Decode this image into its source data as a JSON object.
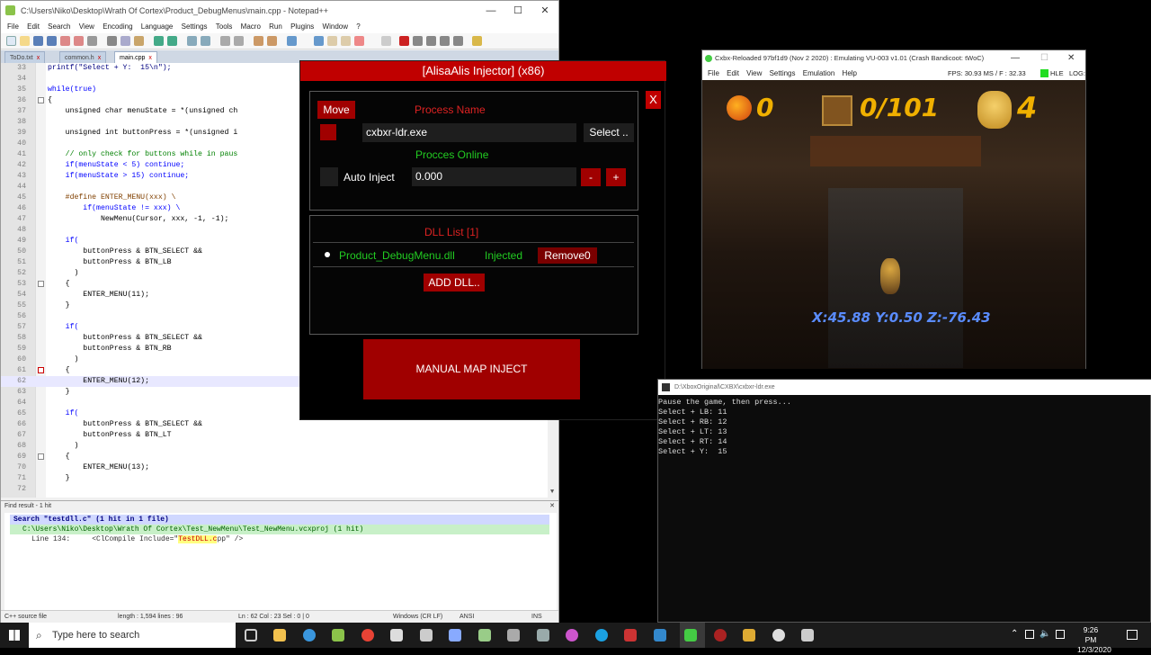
{
  "notepad": {
    "title": "C:\\Users\\Niko\\Desktop\\Wrath Of Cortex\\Product_DebugMenus\\main.cpp - Notepad++",
    "menu": [
      "File",
      "Edit",
      "Search",
      "View",
      "Encoding",
      "Language",
      "Settings",
      "Tools",
      "Macro",
      "Run",
      "Plugins",
      "Window",
      "?"
    ],
    "tabs": [
      "ToDo.txt",
      "common.h",
      "main.cpp"
    ],
    "lines": [
      {
        "n": "33",
        "t": "printf(\"Select + Y:  15\\n\");"
      },
      {
        "n": "34",
        "t": ""
      },
      {
        "n": "35",
        "t": "while(true)"
      },
      {
        "n": "36",
        "t": "{"
      },
      {
        "n": "37",
        "t": "    unsigned char menuState = *(unsigned ch"
      },
      {
        "n": "38",
        "t": ""
      },
      {
        "n": "39",
        "t": "    unsigned int buttonPress = *(unsigned i"
      },
      {
        "n": "40",
        "t": ""
      },
      {
        "n": "41",
        "t": "    // only check for buttons while in paus"
      },
      {
        "n": "42",
        "t": "    if(menuState < 5) continue;"
      },
      {
        "n": "43",
        "t": "    if(menuState > 15) continue;"
      },
      {
        "n": "44",
        "t": ""
      },
      {
        "n": "45",
        "t": "    #define ENTER_MENU(xxx) \\"
      },
      {
        "n": "46",
        "t": "        if(menuState != xxx) \\"
      },
      {
        "n": "47",
        "t": "            NewMenu(Cursor, xxx, -1, -1);"
      },
      {
        "n": "48",
        "t": ""
      },
      {
        "n": "49",
        "t": "    if("
      },
      {
        "n": "50",
        "t": "        buttonPress & BTN_SELECT &&"
      },
      {
        "n": "51",
        "t": "        buttonPress & BTN_LB"
      },
      {
        "n": "52",
        "t": "      )"
      },
      {
        "n": "53",
        "t": "    {"
      },
      {
        "n": "54",
        "t": "        ENTER_MENU(11);"
      },
      {
        "n": "55",
        "t": "    }"
      },
      {
        "n": "56",
        "t": ""
      },
      {
        "n": "57",
        "t": "    if("
      },
      {
        "n": "58",
        "t": "        buttonPress & BTN_SELECT &&"
      },
      {
        "n": "59",
        "t": "        buttonPress & BTN_RB"
      },
      {
        "n": "60",
        "t": "      )"
      },
      {
        "n": "61",
        "t": "    {"
      },
      {
        "n": "62",
        "t": "        ENTER_MENU(12);"
      },
      {
        "n": "63",
        "t": "    }"
      },
      {
        "n": "64",
        "t": ""
      },
      {
        "n": "65",
        "t": "    if("
      },
      {
        "n": "66",
        "t": "        buttonPress & BTN_SELECT &&"
      },
      {
        "n": "67",
        "t": "        buttonPress & BTN_LT"
      },
      {
        "n": "68",
        "t": "      )"
      },
      {
        "n": "69",
        "t": "    {"
      },
      {
        "n": "70",
        "t": "        ENTER_MENU(13);"
      },
      {
        "n": "71",
        "t": "    }"
      },
      {
        "n": "72",
        "t": ""
      }
    ],
    "find_bar": "Find result - 1 hit",
    "find": {
      "search": "Search \"testdll.c\" (1 hit in 1 file)",
      "file": "C:\\Users\\Niko\\Desktop\\Wrath Of Cortex\\Test_NewMenu\\Test_NewMenu.vcxproj (1 hit)",
      "line_prefix": "Line 134:     <ClCompile Include=\"",
      "line_hit": "TestDLL.c",
      "line_suffix": "pp\" />"
    },
    "status": {
      "type": "C++ source file",
      "length": "length : 1,594   lines : 96",
      "pos": "Ln : 62    Col : 23    Sel : 0 | 0",
      "eol": "Windows (CR LF)",
      "enc": "ANSI",
      "mode": "INS"
    }
  },
  "injector": {
    "title": "[AlisaAlis Injector] (x86)",
    "close": "X",
    "move": "Move",
    "process_name_label": "Process Name",
    "process_value": "cxbxr-ldr.exe",
    "select": "Select ..",
    "online": "Procces Online",
    "auto_inject": "Auto Inject",
    "delay": "0.000",
    "minus": "-",
    "plus": "+",
    "dll_list_title": "DLL List [1]",
    "dll_name": "Product_DebugMenu.dll",
    "dll_status": "Injected",
    "remove": "Remove0",
    "add": "ADD DLL..",
    "manual": "MANUAL MAP INJECT",
    "colors": {
      "red": "#c00000",
      "green": "#22cc22"
    }
  },
  "cxbx": {
    "title": "Cxbx-Reloaded 97bf1d9 (Nov  2 2020) : Emulating VU-003 v1.01 (Crash Bandicoot: tWoC)",
    "menu": [
      "File",
      "Edit",
      "View",
      "Settings",
      "Emulation",
      "Help"
    ],
    "fps": "FPS: 30.93  MS / F : 32.33",
    "hle": "HLE",
    "log": "LOG:",
    "hud": {
      "fruit": "0",
      "crates": "0/101",
      "lives": "4"
    },
    "coords": "X:45.88 Y:0.50 Z:-76.43"
  },
  "console": {
    "title": "D:\\XboxOriginal\\CXBX\\cxbxr-ldr.exe",
    "lines": [
      "Pause the game, then press...",
      "Select + LB: 11",
      "Select + RB: 12",
      "Select + LT: 13",
      "Select + RT: 14",
      "Select + Y:  15"
    ]
  },
  "taskbar": {
    "search_placeholder": "Type here to search",
    "time": "9:26 PM",
    "date": "12/3/2020"
  }
}
